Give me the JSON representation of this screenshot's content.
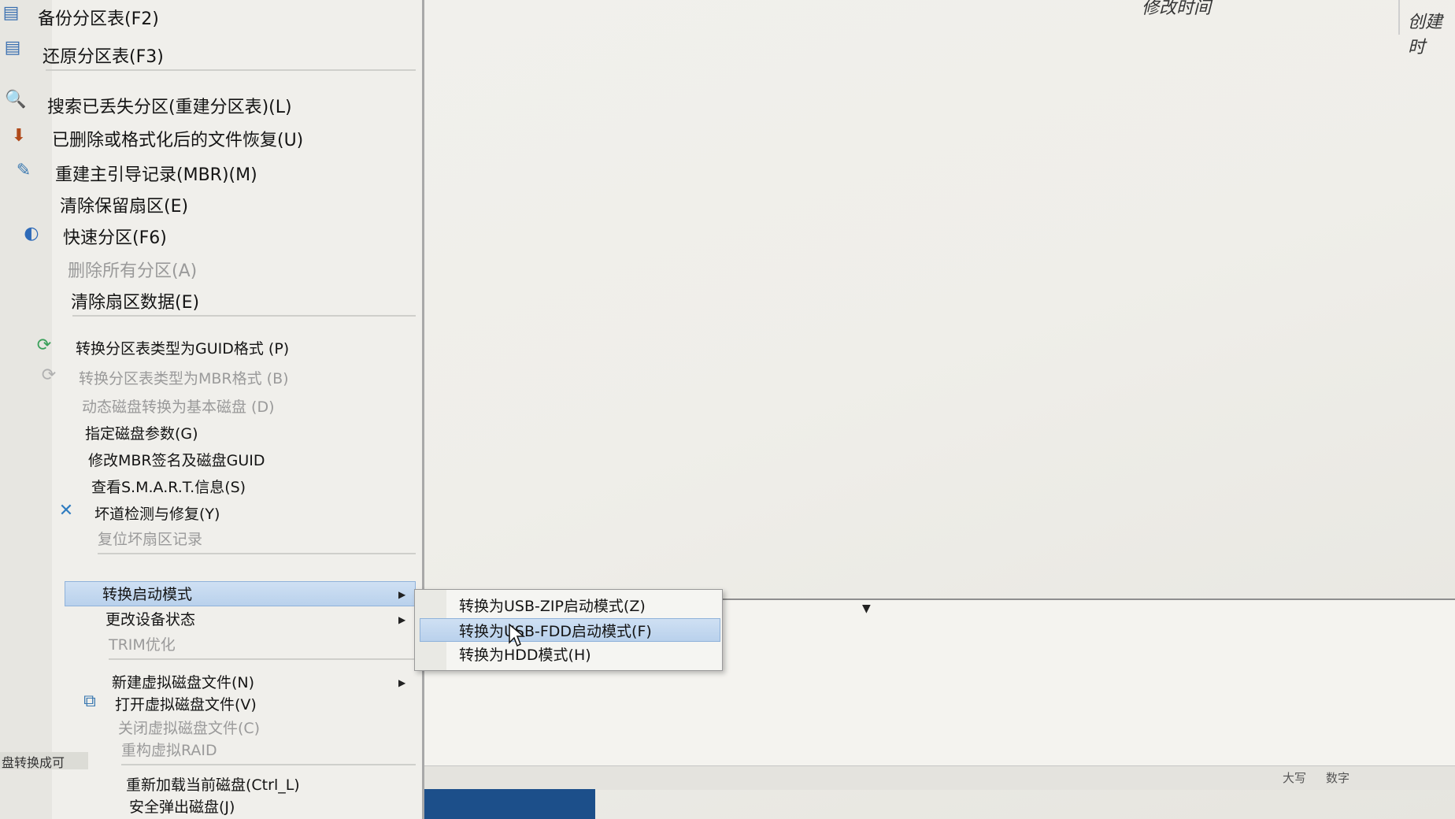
{
  "header": {
    "col1": "修改时间",
    "col2": "创建时"
  },
  "menu": {
    "items": [
      {
        "label": "备份分区表(F2)"
      },
      {
        "label": "还原分区表(F3)"
      },
      {
        "label": "搜索已丢失分区(重建分区表)(L)"
      },
      {
        "label": "已删除或格式化后的文件恢复(U)"
      },
      {
        "label": "重建主引导记录(MBR)(M)"
      },
      {
        "label": "清除保留扇区(E)"
      },
      {
        "label": "快速分区(F6)"
      },
      {
        "label": "删除所有分区(A)"
      },
      {
        "label": "清除扇区数据(E)"
      },
      {
        "label": "转换分区表类型为GUID格式 (P)"
      },
      {
        "label": "转换分区表类型为MBR格式 (B)"
      },
      {
        "label": "动态磁盘转换为基本磁盘 (D)"
      },
      {
        "label": "指定磁盘参数(G)"
      },
      {
        "label": "修改MBR签名及磁盘GUID"
      },
      {
        "label": "查看S.M.A.R.T.信息(S)"
      },
      {
        "label": "坏道检测与修复(Y)"
      },
      {
        "label": "复位坏扇区记录"
      },
      {
        "label": "转换启动模式"
      },
      {
        "label": "更改设备状态"
      },
      {
        "label": "TRIM优化"
      },
      {
        "label": "新建虚拟磁盘文件(N)"
      },
      {
        "label": "打开虚拟磁盘文件(V)"
      },
      {
        "label": "关闭虚拟磁盘文件(C)"
      },
      {
        "label": "重构虚拟RAID"
      },
      {
        "label": "重新加载当前磁盘(Ctrl_L)"
      },
      {
        "label": "安全弹出磁盘(J)"
      }
    ]
  },
  "submenu": {
    "items": [
      {
        "label": "转换为USB-ZIP启动模式(Z)"
      },
      {
        "label": "转换为USB-FDD启动模式(F)"
      },
      {
        "label": "转换为HDD模式(H)"
      }
    ]
  },
  "status": {
    "left": "盘转换成可",
    "caps": "大写",
    "num": "数字"
  }
}
